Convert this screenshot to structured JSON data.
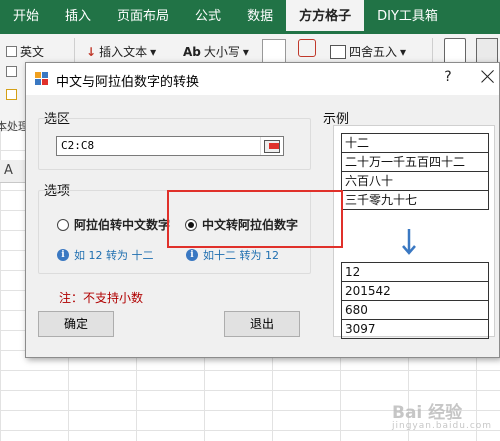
{
  "excel": {
    "tabs": [
      "开始",
      "插入",
      "页面布局",
      "公式",
      "数据",
      "方方格子",
      "DIY工具箱"
    ],
    "active_tab": "方方格子",
    "ribbon": {
      "english_label": "英文",
      "insert_text_label": "插入文本",
      "case_label": "大小写",
      "round_label": "四舍五入",
      "case_icon_text": "Ab",
      "dropdown_glyph": "▾"
    },
    "namebox_fragment": "本处理",
    "column_header": "A",
    "brand_color": "#217346"
  },
  "dialog": {
    "title": "中文与阿拉伯数字的转换",
    "help_label": "?",
    "range_section_label": "选区",
    "range_value": "C2:C8",
    "options_section_label": "选项",
    "option_to_chinese": "阿拉伯转中文数字",
    "option_to_arabic": "中文转阿拉伯数字",
    "selected_option": "中文转阿拉伯数字",
    "hint_to_chinese": "如 12 转为 十二",
    "hint_to_arabic": "如十二 转为 12",
    "info_glyph": "i",
    "note": "注：不支持小数",
    "ok_button": "确定",
    "exit_button": "退出",
    "example_section_label": "示例",
    "example_chinese": [
      "十二",
      "二十万一千五百四十二",
      "六百八十",
      "三千零九十七"
    ],
    "example_arabic": [
      "12",
      "201542",
      "680",
      "3097"
    ],
    "highlight_color": "#e0302a",
    "note_color": "#b00000",
    "arrow_color": "#3a78c2"
  },
  "watermark": {
    "text": "Bai 经验",
    "sub": "jingyan.baidu.com"
  }
}
